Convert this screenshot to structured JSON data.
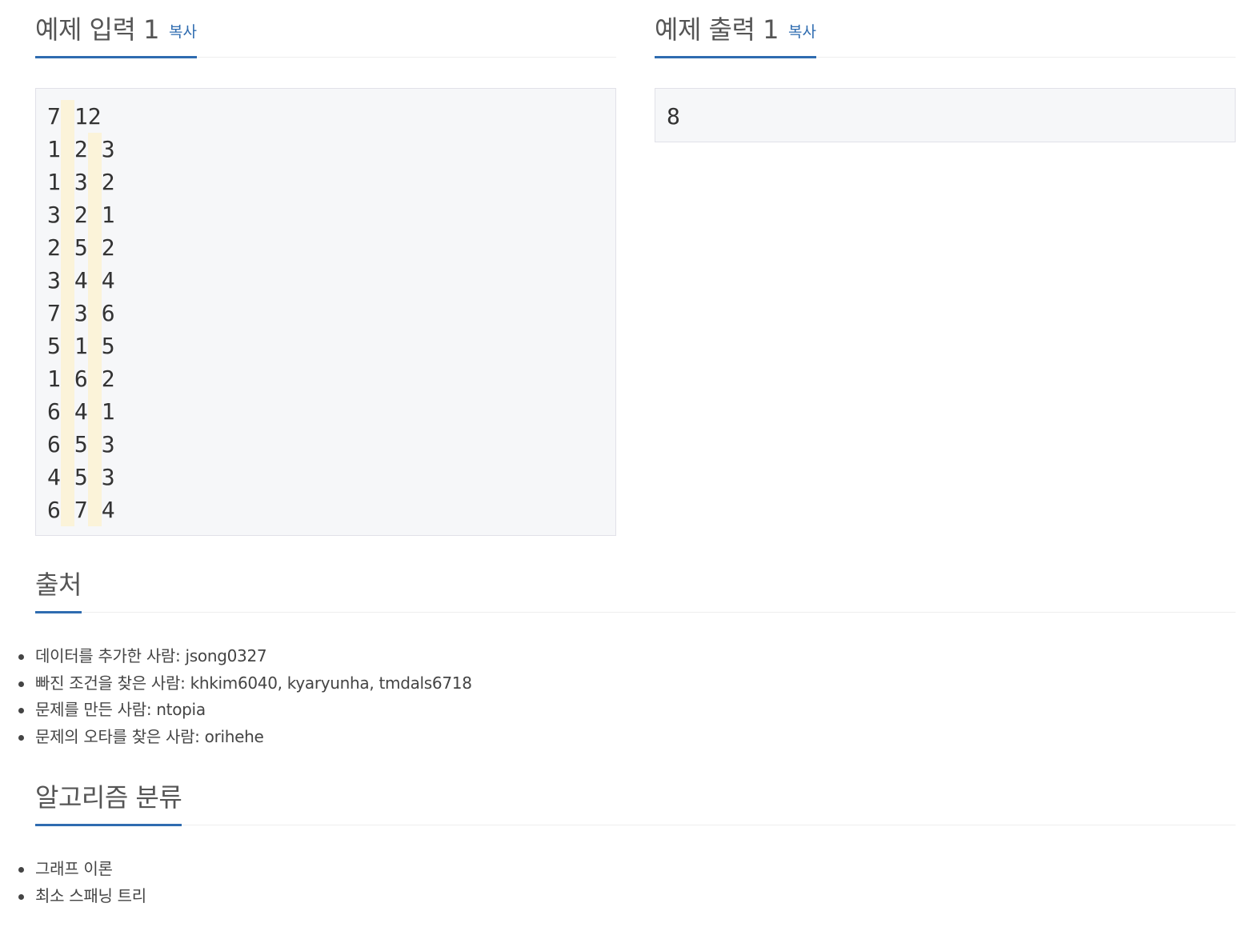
{
  "sample_input": {
    "heading": "예제 입력 1",
    "copy_label": "복사",
    "lines": [
      [
        "7",
        "12"
      ],
      [
        "1",
        "2",
        "3"
      ],
      [
        "1",
        "3",
        "2"
      ],
      [
        "3",
        "2",
        "1"
      ],
      [
        "2",
        "5",
        "2"
      ],
      [
        "3",
        "4",
        "4"
      ],
      [
        "7",
        "3",
        "6"
      ],
      [
        "5",
        "1",
        "5"
      ],
      [
        "1",
        "6",
        "2"
      ],
      [
        "6",
        "4",
        "1"
      ],
      [
        "6",
        "5",
        "3"
      ],
      [
        "4",
        "5",
        "3"
      ],
      [
        "6",
        "7",
        "4"
      ]
    ]
  },
  "sample_output": {
    "heading": "예제 출력 1",
    "copy_label": "복사",
    "lines": [
      [
        "8"
      ]
    ]
  },
  "source": {
    "heading": "출처",
    "items": [
      "데이터를 추가한 사람: jsong0327",
      "빠진 조건을 찾은 사람: khkim6040, kyaryunha, tmdals6718",
      "문제를 만든 사람: ntopia",
      "문제의 오타를 찾은 사람: orihehe"
    ]
  },
  "algorithm": {
    "heading": "알고리즘 분류",
    "items": [
      "그래프 이론",
      "최소 스패닝 트리"
    ]
  },
  "colors": {
    "accent": "#2f6cb0",
    "box_bg": "#f6f7f9",
    "space_highlight": "#fbf3d9"
  }
}
